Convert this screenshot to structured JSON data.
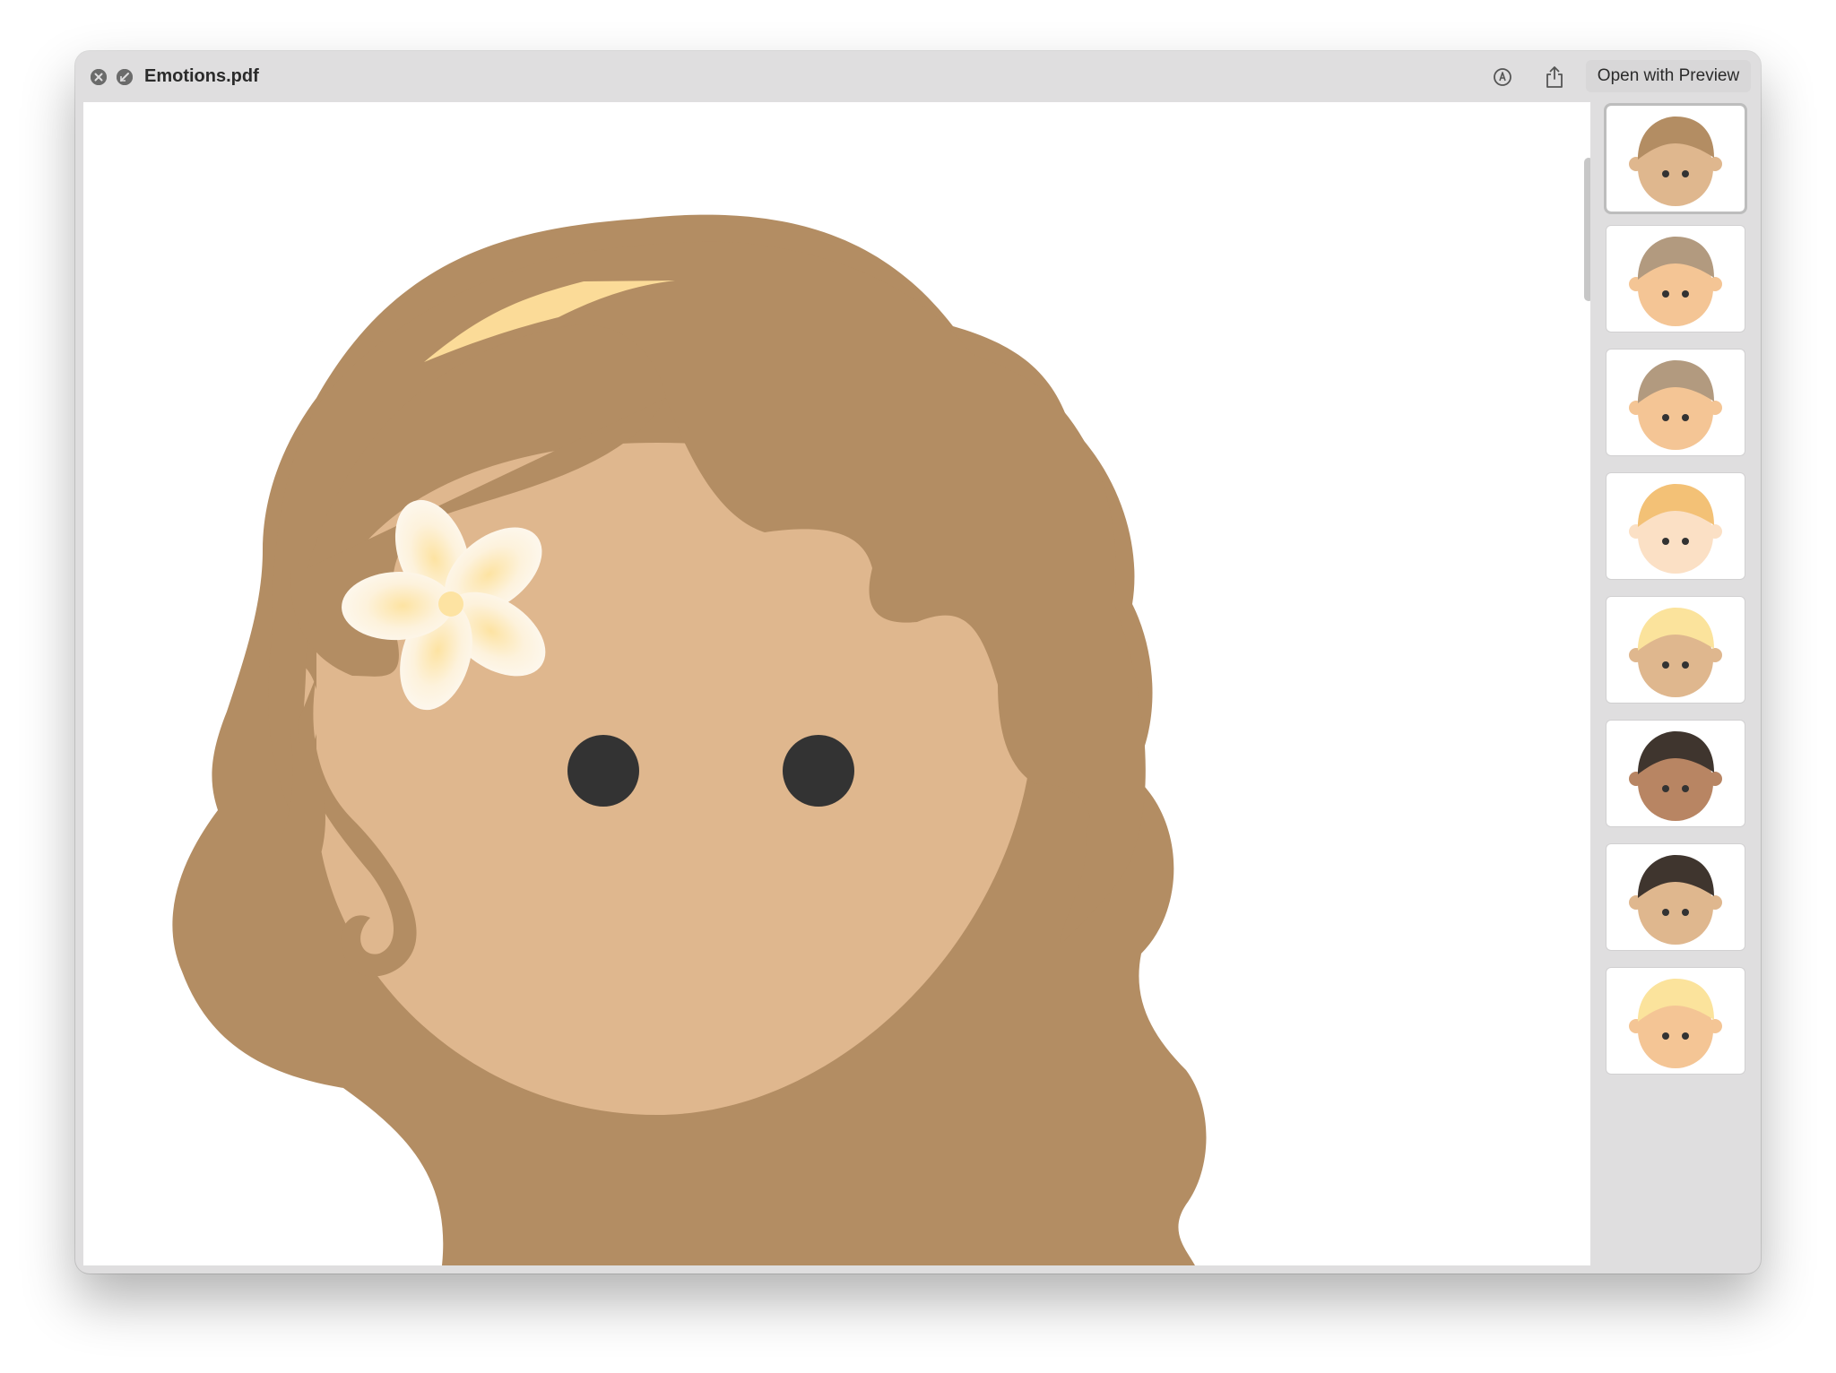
{
  "window": {
    "title": "Emotions.pdf"
  },
  "toolbar": {
    "close_icon": "close-icon",
    "fullscreen_icon": "fullscreen-icon",
    "markup_icon": "markup-icon",
    "share_icon": "share-icon",
    "open_label": "Open with Preview"
  },
  "colors": {
    "window_bg": "#dfdedf",
    "hair": "#b38d63",
    "skin": "#dfb78e",
    "eye": "#333333",
    "highlight": "#fbdb98"
  },
  "thumbnails": [
    {
      "name": "thumb-1",
      "hair": "#b38d63",
      "skin": "#dfb78e",
      "selected": true
    },
    {
      "name": "thumb-2",
      "hair": "#b29a7f",
      "skin": "#f4c595",
      "selected": false
    },
    {
      "name": "thumb-3",
      "hair": "#b29a7f",
      "skin": "#f4c595",
      "selected": false
    },
    {
      "name": "thumb-4",
      "hair": "#f3c176",
      "skin": "#fbe0c5",
      "selected": false
    },
    {
      "name": "thumb-5",
      "hair": "#fbe39c",
      "skin": "#dfb78e",
      "selected": false
    },
    {
      "name": "thumb-6",
      "hair": "#3f352e",
      "skin": "#b88563",
      "selected": false
    },
    {
      "name": "thumb-7",
      "hair": "#3f352e",
      "skin": "#dfb78e",
      "selected": false
    },
    {
      "name": "thumb-8",
      "hair": "#fbe39c",
      "skin": "#f4c595",
      "selected": false
    }
  ]
}
